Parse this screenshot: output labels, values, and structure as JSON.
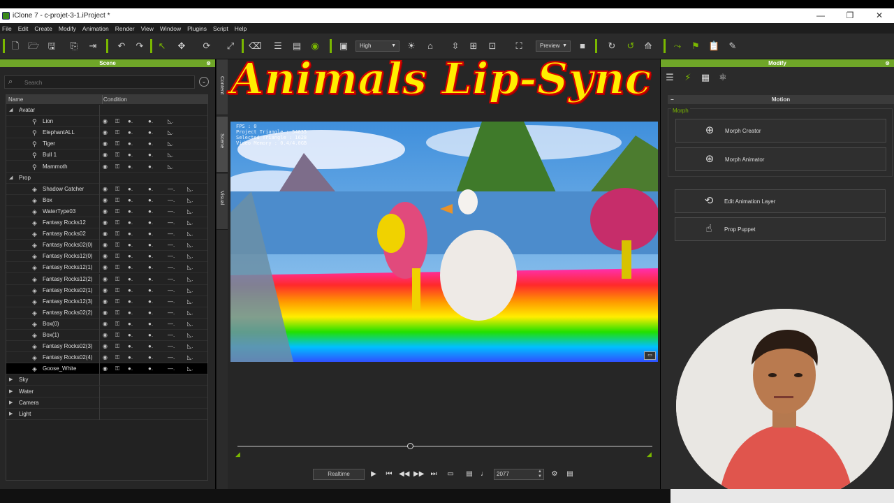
{
  "window": {
    "title": "iClone 7 - c-projet-3-1.iProject *",
    "controls": [
      "—",
      "❐",
      "✕"
    ]
  },
  "menu": [
    "File",
    "Edit",
    "Create",
    "Modify",
    "Animation",
    "Render",
    "View",
    "Window",
    "Plugins",
    "Script",
    "Help"
  ],
  "toolbar": {
    "quality": "High",
    "render_mode": "Preview"
  },
  "overlay_title": "Animals Lip-Sync",
  "scene_panel": {
    "title": "Scene",
    "search_placeholder": "Search",
    "col_name": "Name",
    "col_condition": "Condition",
    "groups": {
      "avatar": "Avatar",
      "prop": "Prop",
      "sky": "Sky",
      "water": "Water",
      "camera": "Camera",
      "light": "Light"
    },
    "avatars": [
      "Lion",
      "ElephantALL",
      "Tiger",
      "Bull 1",
      "Mammoth"
    ],
    "props": [
      "Shadow Catcher",
      "Box",
      "WaterType03",
      "Fantasy Rocks12",
      "Fantasy Rocks02",
      "Fantasy Rocks02(0)",
      "Fantasy Rocks12(0)",
      "Fantasy Rocks12(1)",
      "Fantasy Rocks12(2)",
      "Fantasy Rocks02(1)",
      "Fantasy Rocks12(3)",
      "Fantasy Rocks02(2)",
      "Box(0)",
      "Box(1)",
      "Fantasy Rocks02(3)",
      "Fantasy Rocks02(4)",
      "Goose_White"
    ],
    "selected_item": "Goose_White"
  },
  "side_tabs": [
    "Content",
    "Scene",
    "Visual"
  ],
  "viewport": {
    "stats": [
      "FPS : 0",
      "Project Triangle : 54835",
      "Selected Triangle : 1628",
      "Video Memory : 0.4/4.0GB"
    ]
  },
  "playback": {
    "realtime_label": "Realtime",
    "frame": "2077"
  },
  "modify_panel": {
    "title": "Modify",
    "section": "Motion",
    "morph_group": "Morph",
    "buttons": {
      "morph_creator": "Morph Creator",
      "morph_animator": "Morph Animator",
      "edit_anim_layer": "Edit Animation Layer",
      "prop_puppet": "Prop Puppet"
    }
  },
  "colors": {
    "accent": "#7ab800",
    "panel_header": "#6fa628",
    "title_fill": "#ffee00",
    "title_stroke": "#d40000"
  }
}
